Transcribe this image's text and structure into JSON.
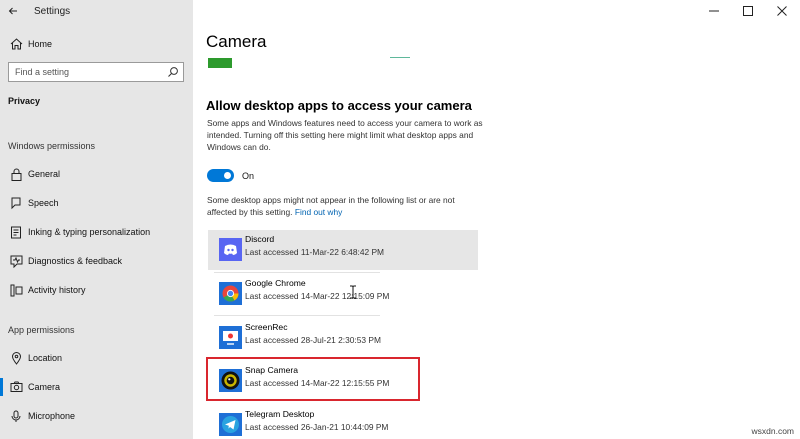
{
  "window": {
    "title": "Settings"
  },
  "sidebar": {
    "home_label": "Home",
    "search_placeholder": "Find a setting",
    "category": "Privacy",
    "sections": [
      {
        "label": "Windows permissions",
        "items": [
          {
            "label": "General",
            "icon": "lock-icon"
          },
          {
            "label": "Speech",
            "icon": "microphone-speech-icon"
          },
          {
            "label": "Inking & typing personalization",
            "icon": "inking-icon"
          },
          {
            "label": "Diagnostics & feedback",
            "icon": "diagnostics-icon"
          },
          {
            "label": "Activity history",
            "icon": "activity-history-icon"
          }
        ]
      },
      {
        "label": "App permissions",
        "items": [
          {
            "label": "Location",
            "icon": "location-icon"
          },
          {
            "label": "Camera",
            "icon": "camera-icon",
            "selected": true
          },
          {
            "label": "Microphone",
            "icon": "microphone-icon"
          }
        ]
      }
    ]
  },
  "main": {
    "page_title": "Camera",
    "section_heading": "Allow desktop apps to access your camera",
    "description": "Some apps and Windows features need to access your camera to work as intended. Turning off this setting here might limit what desktop apps and Windows can do.",
    "toggle": {
      "state_label": "On",
      "on": true
    },
    "note_text": "Some desktop apps might not appear in the following list or are not affected by this setting.",
    "note_link": "Find out why",
    "apps": [
      {
        "name": "Discord",
        "last_accessed": "Last accessed 11-Mar-22 6:48:42 PM",
        "icon": "discord-icon"
      },
      {
        "name": "Google Chrome",
        "last_accessed": "Last accessed 14-Mar-22 12:15:09 PM",
        "icon": "chrome-icon"
      },
      {
        "name": "ScreenRec",
        "last_accessed": "Last accessed 28-Jul-21 2:30:53 PM",
        "icon": "screenrec-icon"
      },
      {
        "name": "Snap Camera",
        "last_accessed": "Last accessed 14-Mar-22 12:15:55 PM",
        "icon": "snap-camera-icon"
      },
      {
        "name": "Telegram Desktop",
        "last_accessed": "Last accessed 26-Jan-21 10:44:09 PM",
        "icon": "telegram-icon"
      }
    ]
  },
  "watermark": "wsxdn.com",
  "colors": {
    "accent": "#0078d7",
    "sidebar_bg": "#e6e6e6",
    "highlight_border": "#d9262e",
    "link": "#0063b1"
  }
}
